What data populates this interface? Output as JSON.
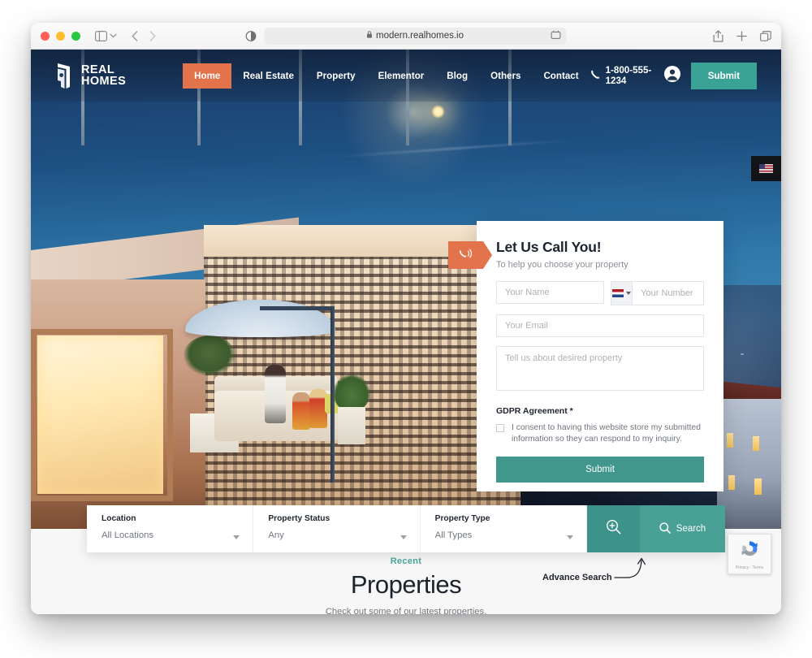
{
  "browser": {
    "url": "modern.realhomes.io",
    "lock_icon": "lock-icon",
    "sidebar_icon": "sidebar-icon",
    "back_icon": "chevron-left-icon",
    "forward_icon": "chevron-right-icon",
    "reader_icon": "reader-mode-icon",
    "extension_icon": "extension-icon",
    "share_icon": "share-icon",
    "newtab_icon": "plus-icon",
    "tabs_icon": "tabs-overview-icon"
  },
  "header": {
    "logo_line1": "REAL",
    "logo_line2": "HOMES",
    "nav": [
      {
        "label": "Home",
        "active": true
      },
      {
        "label": "Real Estate",
        "active": false
      },
      {
        "label": "Property",
        "active": false
      },
      {
        "label": "Elementor",
        "active": false
      },
      {
        "label": "Blog",
        "active": false
      },
      {
        "label": "Others",
        "active": false
      },
      {
        "label": "Contact",
        "active": false
      }
    ],
    "phone": "1-800-555-1234",
    "phone_icon": "phone-icon",
    "account_icon": "user-account-icon",
    "submit_label": "Submit",
    "language_flag": "us-flag-icon"
  },
  "callback_card": {
    "ribbon_icon": "phone-ringing-icon",
    "title": "Let Us Call You!",
    "subtitle": "To help you choose your property",
    "name_placeholder": "Your Name",
    "number_placeholder": "Your Number",
    "email_placeholder": "Your Email",
    "message_placeholder": "Tell us about desired property",
    "country_flag": "nl-flag-icon",
    "gdpr_label": "GDPR Agreement *",
    "gdpr_text": "I consent to having this website store my submitted information so they can respond to my inquiry.",
    "submit_label": "Submit"
  },
  "search_bar": {
    "fields": [
      {
        "label": "Location",
        "value": "All Locations"
      },
      {
        "label": "Property Status",
        "value": "Any"
      },
      {
        "label": "Property Type",
        "value": "All Types"
      }
    ],
    "advance_icon": "zoom-in-icon",
    "search_icon": "search-icon",
    "search_label": "Search"
  },
  "annotation": {
    "text": "Advance Search",
    "arrow_icon": "curved-arrow-icon"
  },
  "recaptcha": {
    "icon": "recaptcha-icon",
    "terms": "Privacy - Terms"
  },
  "properties_section": {
    "kicker": "Recent",
    "title": "Properties",
    "subtitle": "Check out some of our latest properties."
  },
  "colors": {
    "accent_orange": "#e2734a",
    "accent_teal": "#3aa395",
    "search_teal": "#49a195",
    "advance_teal": "#3d938a",
    "card_submit_teal": "#41978c",
    "kicker_teal": "#4aa79a",
    "dark_text": "#1d232b"
  }
}
